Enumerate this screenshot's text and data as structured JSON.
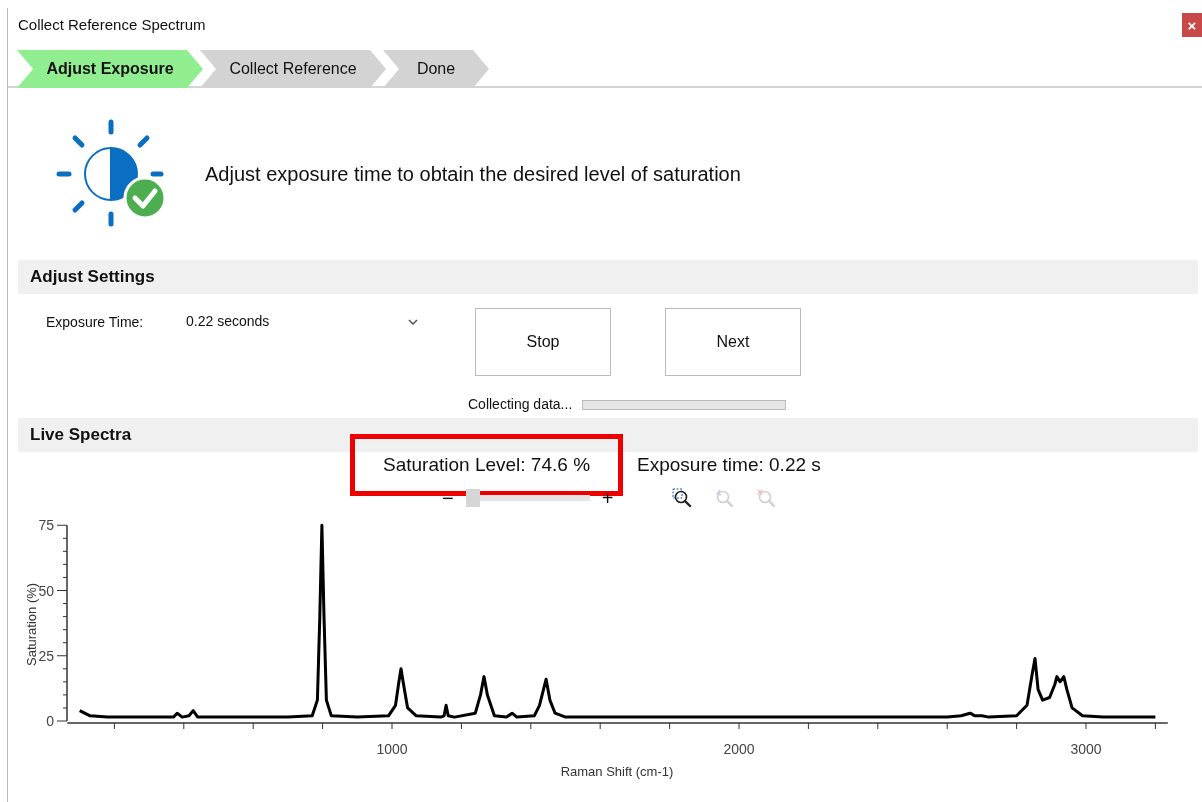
{
  "window": {
    "title": "Collect Reference Spectrum",
    "close": "×"
  },
  "steps": [
    {
      "label": "Adjust Exposure",
      "selected": true
    },
    {
      "label": "Collect Reference",
      "selected": false
    },
    {
      "label": "Done",
      "selected": false
    }
  ],
  "intro": "Adjust exposure time to obtain the desired level of saturation",
  "settings": {
    "heading": "Adjust Settings",
    "exposure_label": "Exposure Time:",
    "exposure_value": "0.22 seconds",
    "buttons": [
      "Stop",
      "Next"
    ],
    "progress": {
      "label": "Collecting data...",
      "level": 0
    }
  },
  "live": {
    "heading": "Live Spectra",
    "saturation": "Saturation Level: 74.6 %",
    "highlighted": true,
    "exposure": "Exposure time: 0.22 s",
    "zoom_minus": "−",
    "zoom_plus": "+",
    "zoom_slider": {
      "level": 0
    },
    "tools": [
      {
        "kind": "zoom-region",
        "disabled": false
      },
      {
        "kind": "zoom-back",
        "disabled": true
      },
      {
        "kind": "zoom-reset",
        "disabled": true
      }
    ],
    "chart_data": {
      "type": "line",
      "xlabel": "Raman Shift (cm-1)",
      "ylabel": "Saturation (%)",
      "xlim": [
        70,
        3230
      ],
      "ylim": [
        0,
        75
      ],
      "xticks": [
        1000,
        2000,
        3000
      ],
      "yticks": [
        0,
        25,
        50,
        75
      ],
      "x": [
        100,
        130,
        180,
        300,
        370,
        381,
        395,
        415,
        427,
        440,
        500,
        700,
        770,
        785,
        792,
        798,
        804,
        811,
        825,
        900,
        990,
        1010,
        1020,
        1026,
        1032,
        1045,
        1070,
        1140,
        1150,
        1156,
        1162,
        1180,
        1240,
        1255,
        1265,
        1275,
        1295,
        1330,
        1346,
        1360,
        1410,
        1425,
        1444,
        1455,
        1470,
        1500,
        2000,
        2400,
        2600,
        2640,
        2666,
        2680,
        2700,
        2720,
        2800,
        2830,
        2845,
        2853,
        2862,
        2875,
        2895,
        2910,
        2916,
        2925,
        2936,
        2945,
        2960,
        2990,
        3050,
        3200
      ],
      "series": [
        {
          "color": "#000000",
          "values": [
            4,
            2,
            1.5,
            1.5,
            1.5,
            3,
            1.5,
            2,
            4,
            1.5,
            1.5,
            1.5,
            2,
            8,
            40,
            75,
            40,
            8,
            2,
            1.5,
            2,
            6,
            15,
            20,
            15,
            5,
            2,
            1.5,
            2,
            6,
            2,
            1.5,
            3,
            10,
            17,
            10,
            2,
            1.5,
            3,
            1.5,
            2,
            6,
            16,
            8,
            3,
            1.5,
            1.5,
            1.5,
            1.5,
            2,
            3,
            2,
            2,
            1.5,
            2,
            6,
            18,
            24,
            12,
            8,
            9,
            14,
            17,
            15,
            17,
            12,
            5,
            2,
            1.5,
            1.5
          ]
        }
      ]
    }
  }
}
